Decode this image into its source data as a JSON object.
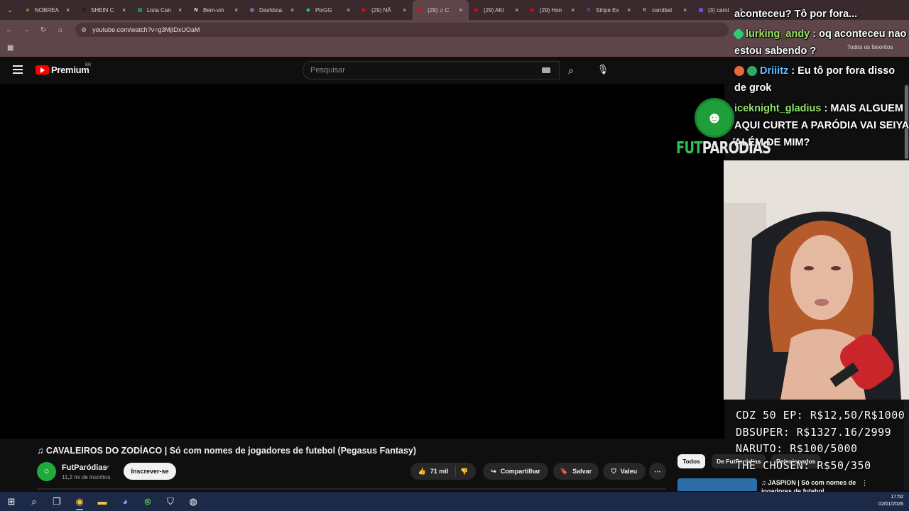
{
  "browser": {
    "tabs": [
      {
        "label": "NOBREA",
        "icon": "amazon-icon",
        "color": "#f0a020",
        "glyph": "a"
      },
      {
        "label": "SHEIN C",
        "icon": "shein-icon",
        "color": "#111111",
        "glyph": "S"
      },
      {
        "label": "Lista Can",
        "icon": "sheets-icon",
        "color": "#1e9e4a",
        "glyph": "▦"
      },
      {
        "label": "Bem-vin",
        "icon": "notion-icon",
        "color": "#ffffff",
        "glyph": "N"
      },
      {
        "label": "Dashboa",
        "icon": "globe-icon",
        "color": "#8ab4f8",
        "glyph": "◎"
      },
      {
        "label": "PixGG",
        "icon": "pixgg-icon",
        "color": "#26c281",
        "glyph": "◆"
      },
      {
        "label": "(29) NÃ",
        "icon": "youtube-icon",
        "color": "#ff0000",
        "glyph": "▶"
      },
      {
        "label": "(29) ♫ C",
        "icon": "youtube-icon",
        "color": "#ff0000",
        "glyph": "▶"
      },
      {
        "label": "(29) AKI",
        "icon": "youtube-icon",
        "color": "#ff0000",
        "glyph": "▶"
      },
      {
        "label": "(29) Hon",
        "icon": "youtube-icon",
        "color": "#ff0000",
        "glyph": "▶"
      },
      {
        "label": "Stripe Ex",
        "icon": "stripe-icon",
        "color": "#635bff",
        "glyph": "S"
      },
      {
        "label": "carolbal",
        "icon": "kick-icon",
        "color": "#53fc18",
        "glyph": "K"
      },
      {
        "label": "(3) carol",
        "icon": "twitch-icon",
        "color": "#9146ff",
        "glyph": "▣"
      }
    ],
    "active_tab_index": 7,
    "url": "youtube.com/watch?v=g3MjtDxUOaM",
    "all_bookmarks_label": "Todos os favoritos"
  },
  "youtube": {
    "logo_text": "Premium",
    "region": "BR",
    "search_placeholder": "Pesquisar",
    "video_title": "♫ CAVALEIROS DO ZODÍACO | Só com nomes de jogadores de futebol (Pegasus Fantasy)",
    "channel_name": "FutParódias",
    "channel_subs": "11,2 mi de inscritos",
    "subscribe_label": "Inscrever-se",
    "likes": "71 mil",
    "share_label": "Compartilhar",
    "save_label": "Salvar",
    "valeu_label": "Valeu",
    "chips": [
      "Todos",
      "De FutParódias",
      "Relacionados"
    ],
    "related_title": "♫ JASPION | Só com nomes de jogadores de futebol"
  },
  "overlay": {
    "chat": [
      {
        "user": "",
        "text": "aconteceu? Tô por fora...",
        "color": "#ffffff"
      },
      {
        "user": "lurking_andy",
        "text": " : oq aconteceu nao estou sabendo ?",
        "color": "#9be562"
      },
      {
        "user": "Driiitz",
        "text": " : Eu tô por fora disso de grok",
        "color": "#5ec3ff"
      },
      {
        "user": "iceknight_gladius",
        "text": " : MAIS ALGUEM AQUI CURTE A PARÓDIA VAI SEIYA ALÉM DE MIM?",
        "color": "#8fe36a"
      }
    ],
    "channel_word_a": "FUT",
    "channel_word_b": "PARÓDIAS",
    "goals": [
      "CDZ 50 EP: R$12,50/R$1000",
      "DBSUPER: R$1327.16/2999",
      "NARUTO: R$100/5000",
      "THE CHOSEN: R$50/350"
    ]
  },
  "system": {
    "time": "17:52",
    "date": "02/01/2026"
  }
}
